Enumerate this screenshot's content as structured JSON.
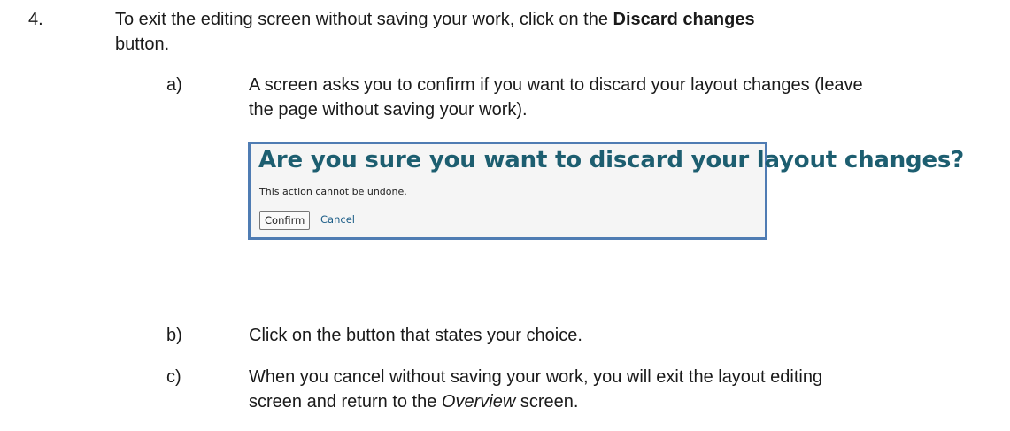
{
  "step": {
    "number": "4.",
    "text_before": "To exit the editing screen without saving your work, click on the ",
    "button_name": "Discard changes",
    "text_after": "button."
  },
  "substeps": {
    "a": {
      "label": "a)",
      "line1": "A screen asks you to confirm if you want to discard your layout changes (leave",
      "line2": "the page without saving your work)."
    },
    "b": {
      "label": "b)",
      "line1": "Click on the button that states your choice."
    },
    "c": {
      "label": "c)",
      "line1": "When you cancel without saving your work, you will exit the layout editing",
      "line2_before": "screen and return to the ",
      "line2_italic": "Overview",
      "line2_after": " screen."
    }
  },
  "dialog": {
    "title": "Are you sure you want to discard your layout changes?",
    "message": "This action cannot be undone.",
    "confirm_label": "Confirm",
    "cancel_label": "Cancel",
    "colors": {
      "title": "#1d5e70",
      "border": "#4f7cb3",
      "link": "#1d5e88"
    }
  }
}
